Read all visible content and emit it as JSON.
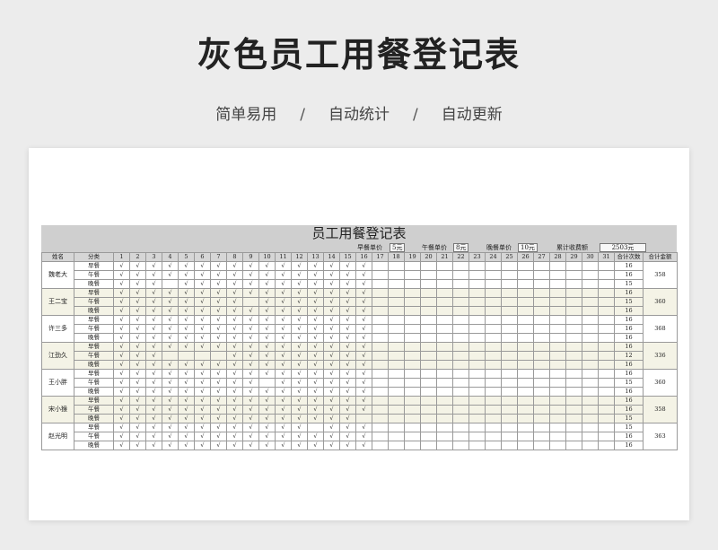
{
  "page": {
    "title": "灰色员工用餐登记表",
    "subtitle": [
      "简单易用",
      "自动统计",
      "自动更新"
    ],
    "separator": "/"
  },
  "sheet": {
    "title": "员工用餐登记表",
    "prices": {
      "breakfast_label": "早餐单价",
      "breakfast_value": "5元",
      "lunch_label": "午餐单价",
      "lunch_value": "8元",
      "dinner_label": "晚餐单价",
      "dinner_value": "10元",
      "total_label": "累计收费额",
      "total_value": "2503元"
    },
    "headers": {
      "name": "姓名",
      "category": "分类",
      "days": [
        "1",
        "2",
        "3",
        "4",
        "5",
        "6",
        "7",
        "8",
        "9",
        "10",
        "11",
        "12",
        "13",
        "14",
        "15",
        "16",
        "17",
        "18",
        "19",
        "20",
        "21",
        "22",
        "23",
        "24",
        "25",
        "26",
        "27",
        "28",
        "29",
        "30",
        "31"
      ],
      "count": "合计次数",
      "amount": "合计金额"
    },
    "check_mark": "√",
    "meals": [
      "早餐",
      "午餐",
      "晚餐"
    ],
    "employees": [
      {
        "name": "魏老大",
        "amount": "358",
        "rows": [
          {
            "days": [
              1,
              2,
              3,
              4,
              5,
              6,
              7,
              8,
              9,
              10,
              11,
              12,
              13,
              14,
              15,
              16
            ],
            "count": "16"
          },
          {
            "days": [
              1,
              2,
              3,
              4,
              5,
              6,
              7,
              8,
              9,
              10,
              11,
              12,
              13,
              14,
              15,
              16
            ],
            "count": "16"
          },
          {
            "days": [
              1,
              2,
              3,
              5,
              6,
              7,
              8,
              9,
              10,
              11,
              12,
              13,
              14,
              15,
              16
            ],
            "count": "15"
          }
        ]
      },
      {
        "name": "王二宝",
        "amount": "360",
        "rows": [
          {
            "days": [
              1,
              2,
              3,
              4,
              5,
              6,
              7,
              8,
              9,
              10,
              11,
              12,
              13,
              14,
              15,
              16
            ],
            "count": "16"
          },
          {
            "days": [
              1,
              2,
              3,
              4,
              5,
              6,
              7,
              8,
              10,
              11,
              12,
              13,
              14,
              15,
              16
            ],
            "count": "15"
          },
          {
            "days": [
              1,
              2,
              3,
              4,
              5,
              6,
              7,
              8,
              9,
              10,
              11,
              12,
              13,
              14,
              15,
              16
            ],
            "count": "16"
          }
        ]
      },
      {
        "name": "许三多",
        "amount": "368",
        "rows": [
          {
            "days": [
              1,
              2,
              3,
              4,
              5,
              6,
              7,
              8,
              9,
              10,
              11,
              12,
              13,
              14,
              15,
              16
            ],
            "count": "16"
          },
          {
            "days": [
              1,
              2,
              3,
              4,
              5,
              6,
              7,
              8,
              9,
              10,
              11,
              12,
              13,
              14,
              15,
              16
            ],
            "count": "16"
          },
          {
            "days": [
              1,
              2,
              3,
              4,
              5,
              6,
              7,
              8,
              9,
              10,
              11,
              12,
              13,
              14,
              15,
              16
            ],
            "count": "16"
          }
        ]
      },
      {
        "name": "江劲久",
        "amount": "336",
        "rows": [
          {
            "days": [
              1,
              2,
              3,
              4,
              5,
              6,
              7,
              8,
              9,
              10,
              11,
              12,
              13,
              14,
              15,
              16
            ],
            "count": "16"
          },
          {
            "days": [
              1,
              2,
              3,
              8,
              9,
              10,
              11,
              12,
              13,
              14,
              15,
              16
            ],
            "count": "12"
          },
          {
            "days": [
              1,
              2,
              3,
              4,
              5,
              6,
              7,
              8,
              9,
              10,
              11,
              12,
              13,
              14,
              15,
              16
            ],
            "count": "16"
          }
        ]
      },
      {
        "name": "王小胖",
        "amount": "360",
        "rows": [
          {
            "days": [
              1,
              2,
              3,
              4,
              5,
              6,
              7,
              8,
              9,
              10,
              11,
              12,
              13,
              14,
              15,
              16
            ],
            "count": "16"
          },
          {
            "days": [
              1,
              2,
              3,
              4,
              5,
              6,
              7,
              8,
              9,
              11,
              12,
              13,
              14,
              15,
              16
            ],
            "count": "15"
          },
          {
            "days": [
              1,
              2,
              3,
              4,
              5,
              6,
              7,
              8,
              9,
              10,
              11,
              12,
              13,
              14,
              15,
              16
            ],
            "count": "16"
          }
        ]
      },
      {
        "name": "宋小猴",
        "amount": "358",
        "rows": [
          {
            "days": [
              1,
              2,
              3,
              4,
              5,
              6,
              7,
              8,
              9,
              10,
              11,
              12,
              13,
              14,
              15,
              16
            ],
            "count": "16"
          },
          {
            "days": [
              1,
              2,
              3,
              4,
              5,
              6,
              7,
              8,
              9,
              10,
              11,
              12,
              13,
              14,
              15,
              16
            ],
            "count": "16"
          },
          {
            "days": [
              1,
              2,
              3,
              4,
              5,
              6,
              7,
              8,
              9,
              10,
              11,
              12,
              13,
              14,
              15
            ],
            "count": "15"
          }
        ]
      },
      {
        "name": "赵光明",
        "amount": "363",
        "rows": [
          {
            "days": [
              1,
              2,
              3,
              4,
              5,
              6,
              7,
              8,
              9,
              10,
              11,
              12,
              14,
              15,
              16
            ],
            "count": "15"
          },
          {
            "days": [
              1,
              2,
              3,
              4,
              5,
              6,
              7,
              8,
              9,
              10,
              11,
              12,
              13,
              14,
              15,
              16
            ],
            "count": "16"
          },
          {
            "days": [
              1,
              2,
              3,
              4,
              5,
              6,
              7,
              8,
              9,
              10,
              11,
              12,
              13,
              14,
              15,
              16
            ],
            "count": "16"
          }
        ]
      }
    ]
  }
}
